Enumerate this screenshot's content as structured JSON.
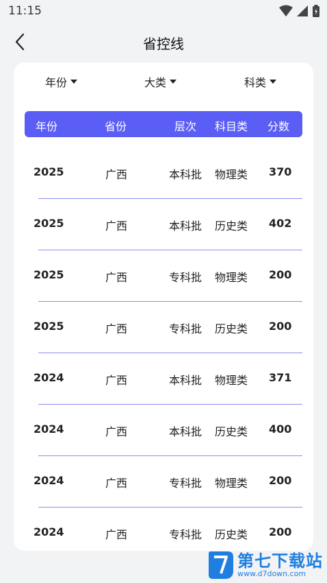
{
  "status": {
    "time": "11:15"
  },
  "nav": {
    "title": "省控线"
  },
  "filters": [
    {
      "label": "年份"
    },
    {
      "label": "大类"
    },
    {
      "label": "科类"
    }
  ],
  "table": {
    "headers": [
      "年份",
      "省份",
      "层次",
      "科目类",
      "分数"
    ],
    "rows": [
      [
        "2025",
        "广西",
        "本科批",
        "物理类",
        "370"
      ],
      [
        "2025",
        "广西",
        "本科批",
        "历史类",
        "402"
      ],
      [
        "2025",
        "广西",
        "专科批",
        "物理类",
        "200"
      ],
      [
        "2025",
        "广西",
        "专科批",
        "历史类",
        "200"
      ],
      [
        "2024",
        "广西",
        "本科批",
        "物理类",
        "371"
      ],
      [
        "2024",
        "广西",
        "本科批",
        "历史类",
        "400"
      ],
      [
        "2024",
        "广西",
        "专科批",
        "物理类",
        "200"
      ],
      [
        "2024",
        "广西",
        "专科批",
        "历史类",
        "200"
      ]
    ]
  },
  "watermark": {
    "title": "第七下载站",
    "url": "www.d7down.com"
  },
  "colors": {
    "accent": "#5b5ef4",
    "divider": "#8a8cf0",
    "watermark": "#1f7fe0"
  },
  "icons": {
    "back": "chevron-left-icon",
    "wifi": "wifi-icon",
    "signal": "signal-icon",
    "battery": "battery-icon"
  }
}
